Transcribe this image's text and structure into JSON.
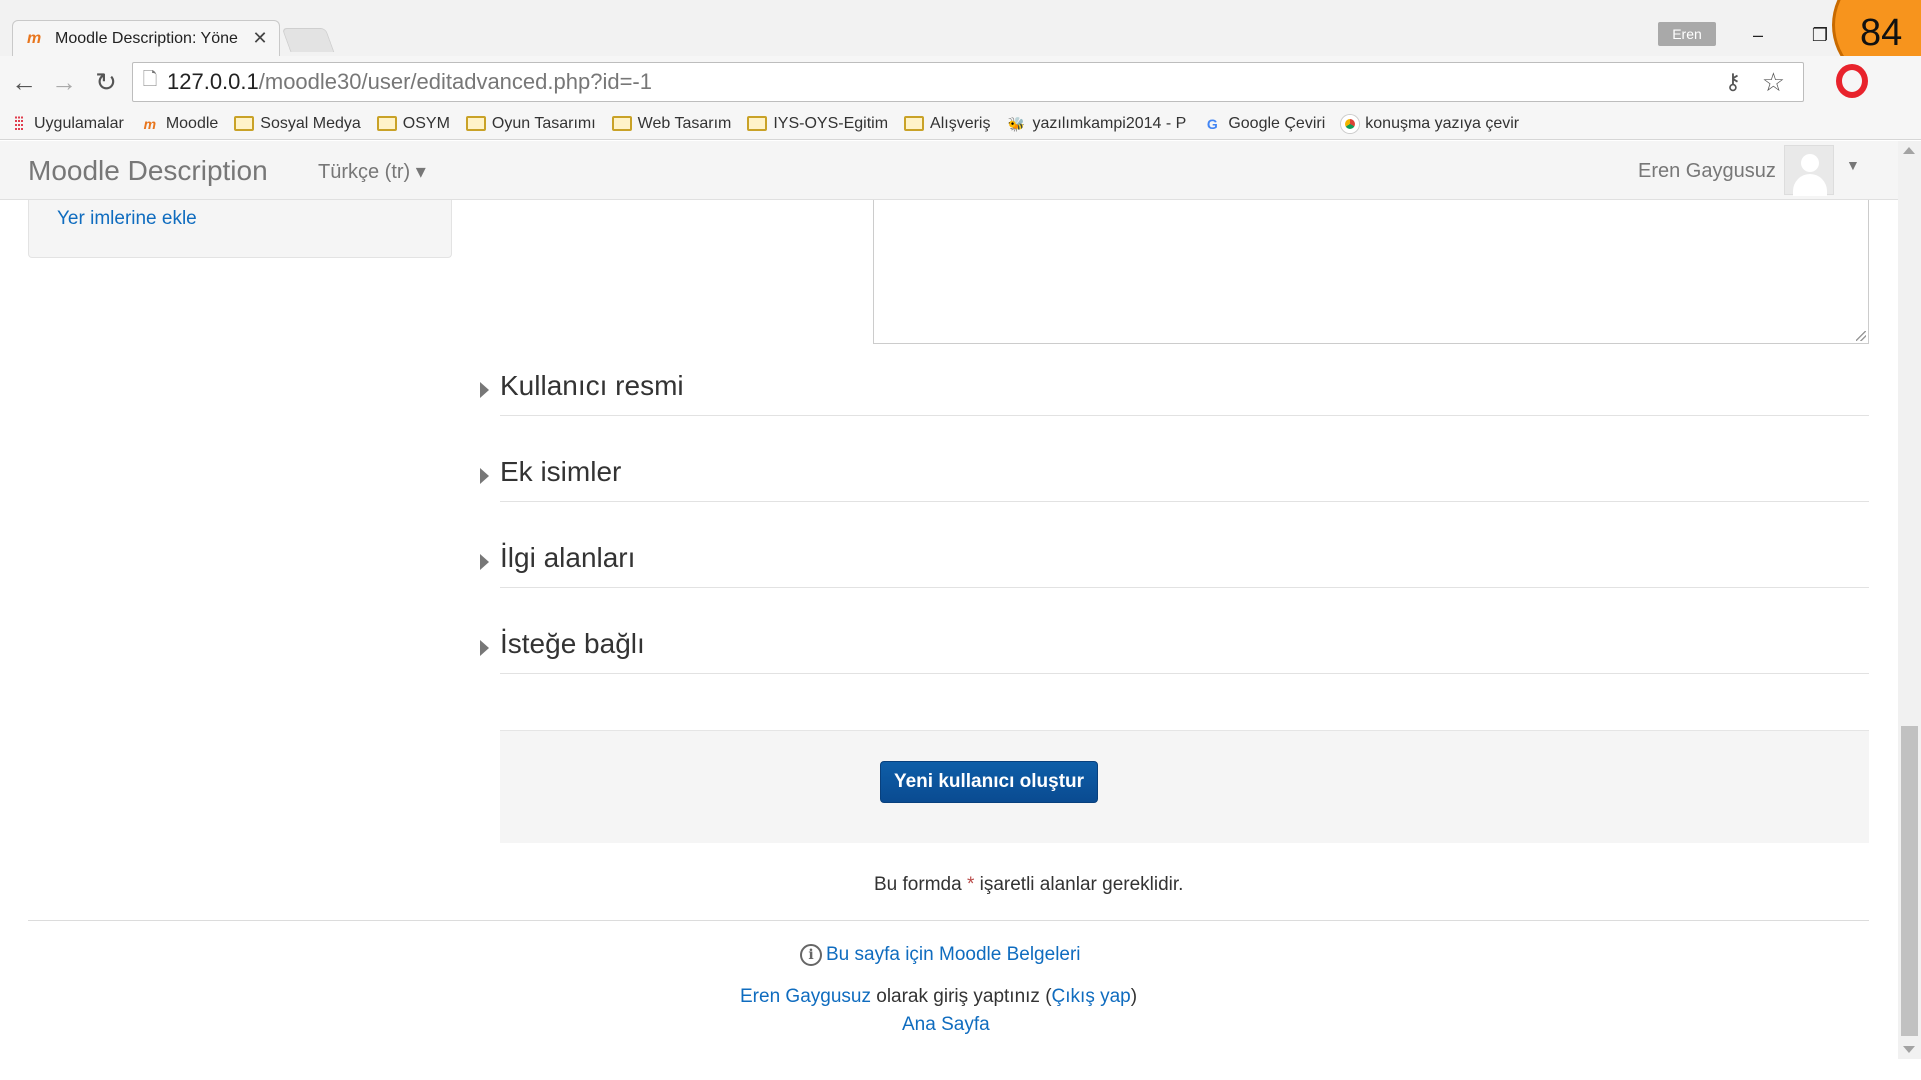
{
  "browser": {
    "tab_title": "Moodle Description: Yöne",
    "tab_close": "✕",
    "profile_name": "Eren",
    "url_host": "127.0.0.1",
    "url_path": "/moodle30/user/editadvanced.php?id=-1",
    "minimize_glyph": "–",
    "restore_glyph": "❐",
    "slide_number": "84",
    "bookmarks": [
      {
        "label": "Uygulamalar",
        "icon": "apps-icon"
      },
      {
        "label": "Moodle",
        "icon": "moodle-icon"
      },
      {
        "label": "Sosyal Medya",
        "icon": "folder-icon"
      },
      {
        "label": "OSYM",
        "icon": "folder-icon"
      },
      {
        "label": "Oyun Tasarımı",
        "icon": "folder-icon"
      },
      {
        "label": "Web Tasarım",
        "icon": "folder-icon"
      },
      {
        "label": "IYS-OYS-Egitim",
        "icon": "folder-icon"
      },
      {
        "label": "Alışveriş",
        "icon": "folder-icon"
      },
      {
        "label": "yazılımkampi2014 - P",
        "icon": "bee-icon"
      },
      {
        "label": "Google Çeviri",
        "icon": "google-translate-icon"
      },
      {
        "label": "konuşma yazıya çevir",
        "icon": "chrome-icon"
      }
    ]
  },
  "navbar": {
    "brand": "Moodle Description",
    "language": "Türkçe (tr) ▾",
    "user_name": "Eren Gaygusuz",
    "user_caret": "▼"
  },
  "block": {
    "link": "Yer imlerine ekle"
  },
  "form": {
    "sections": [
      "Kullanıcı resmi",
      "Ek isimler",
      "İlgi alanları",
      "İsteğe bağlı"
    ],
    "submit_label": "Yeni kullanıcı oluştur",
    "required_prefix": "Bu formda",
    "required_star": "*",
    "required_suffix": "işaretli alanlar gereklidir."
  },
  "footer": {
    "info_glyph": "i",
    "docs_link": "Bu sayfa için Moodle Belgeleri",
    "logged_user": "Eren Gaygusuz",
    "logged_text": "olarak giriş yaptınız (",
    "logout": "Çıkış yap",
    "logged_close": ")",
    "home": "Ana Sayfa"
  },
  "colors": {
    "link": "#0f6cbf",
    "primary": "#0a4b91",
    "required": "#b94a48"
  }
}
